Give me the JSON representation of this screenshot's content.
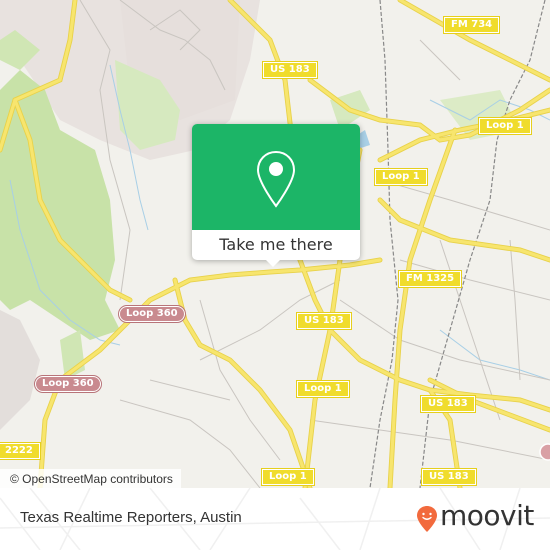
{
  "map": {
    "road_labels": [
      {
        "id": "fm734",
        "text": "FM 734",
        "kind": "highway"
      },
      {
        "id": "us183-top",
        "text": "US 183",
        "kind": "highway"
      },
      {
        "id": "loop1-upper-right",
        "text": "Loop 1",
        "kind": "highway"
      },
      {
        "id": "loop1-upper",
        "text": "Loop 1",
        "kind": "highway"
      },
      {
        "id": "fm1325",
        "text": "FM 1325",
        "kind": "highway"
      },
      {
        "id": "us183-mid",
        "text": "US 183",
        "kind": "highway"
      },
      {
        "id": "loop360-upper",
        "text": "Loop 360",
        "kind": "loop360"
      },
      {
        "id": "loop360-lower",
        "text": "Loop 360",
        "kind": "loop360"
      },
      {
        "id": "loop1-mid",
        "text": "Loop 1",
        "kind": "highway"
      },
      {
        "id": "us183-right",
        "text": "US 183",
        "kind": "highway"
      },
      {
        "id": "fm2222",
        "text": "2222",
        "kind": "highway"
      },
      {
        "id": "loop1-bottom",
        "text": "Loop 1",
        "kind": "highway"
      },
      {
        "id": "us183-bottom",
        "text": "US 183",
        "kind": "highway"
      }
    ],
    "attribution": "© OpenStreetMap contributors",
    "colors": {
      "land": "#f2f1ec",
      "park": "#c8e2a8",
      "residential": "#e8e2df",
      "highway": "#f5e05c",
      "water": "#a8cfe6",
      "rail": "#888888"
    }
  },
  "popup": {
    "icon": "map-pin-icon",
    "button_label": "Take me there",
    "color": "#1cb567"
  },
  "footer": {
    "place_name": "Texas Realtime Reporters, Austin",
    "brand": "moovit",
    "brand_color": "#f26a3d"
  }
}
